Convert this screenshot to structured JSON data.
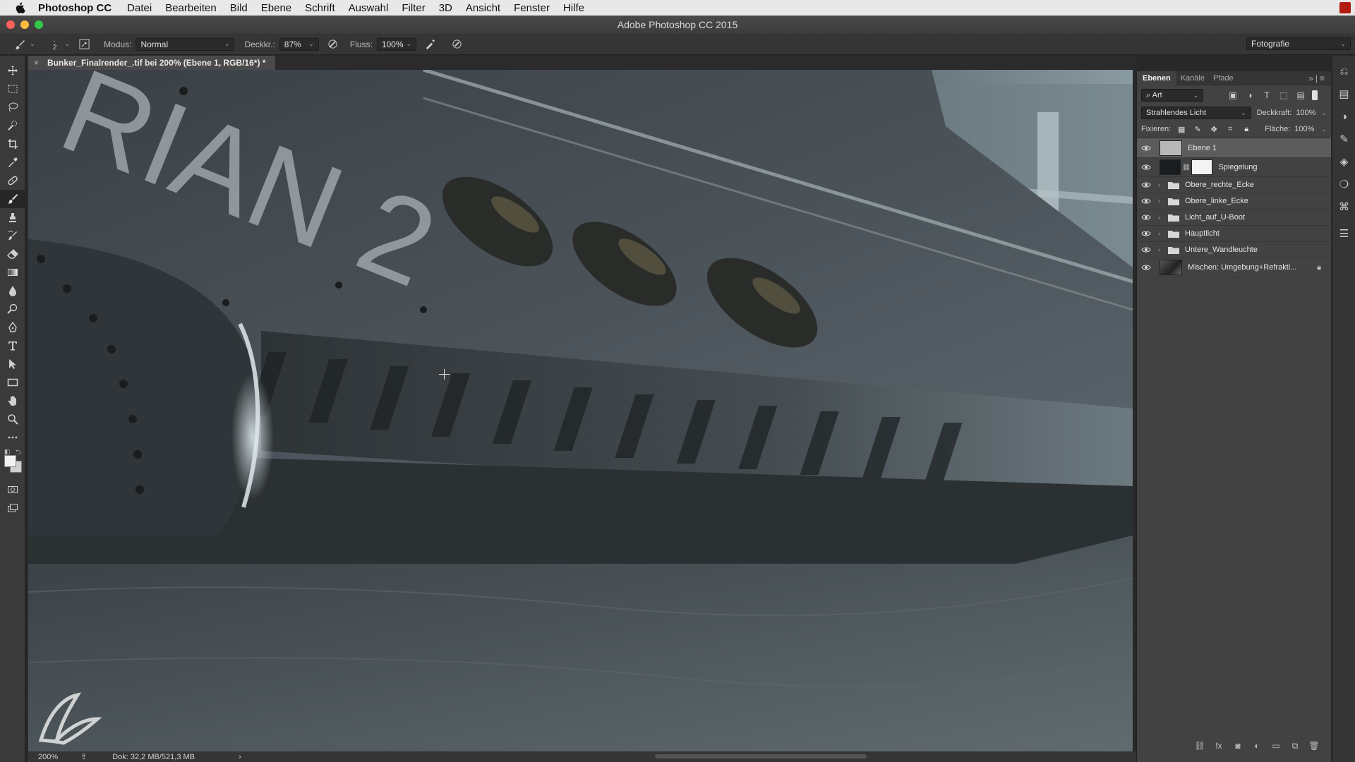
{
  "menubar": {
    "app_name": "Photoshop CC",
    "items": [
      "Datei",
      "Bearbeiten",
      "Bild",
      "Ebene",
      "Schrift",
      "Auswahl",
      "Filter",
      "3D",
      "Ansicht",
      "Fenster",
      "Hilfe"
    ]
  },
  "window": {
    "title": "Adobe Photoshop CC 2015"
  },
  "options_bar": {
    "brush_size": "2",
    "mode_label": "Modus:",
    "mode_value": "Normal",
    "opacity_label": "Deckkr.:",
    "opacity_value": "87%",
    "flow_label": "Fluss:",
    "flow_value": "100%",
    "workspace": "Fotografie"
  },
  "document": {
    "tab_title": "Bunker_Finalrender_.tif bei 200% (Ebene 1, RGB/16*) *",
    "canvas_text": "RIAN 2"
  },
  "status_bar": {
    "zoom": "200%",
    "doc_info": "Dok: 32,2 MB/521,3 MB"
  },
  "layers_panel": {
    "tabs": [
      "Ebenen",
      "Kanäle",
      "Pfade"
    ],
    "filter_kind": "Art",
    "blend_mode": "Strahlendes Licht",
    "opacity_label": "Deckkraft:",
    "opacity_value": "100%",
    "lock_label": "Fixieren:",
    "fill_label": "Fläche:",
    "fill_value": "100%",
    "layers": [
      {
        "name": "Ebene 1",
        "type": "pixel",
        "selected": true
      },
      {
        "name": "Spiegelung",
        "type": "adjustment-mask",
        "selected": false
      },
      {
        "name": "Obere_rechte_Ecke",
        "type": "group",
        "selected": false
      },
      {
        "name": "Obere_linke_Ecke",
        "type": "group",
        "selected": false
      },
      {
        "name": "Licht_auf_U-Boot",
        "type": "group",
        "selected": false
      },
      {
        "name": "Hauptlicht",
        "type": "group",
        "selected": false
      },
      {
        "name": "Untere_Wandleuchte",
        "type": "group",
        "selected": false
      },
      {
        "name": "Mischen: Umgebung+Refrakti...",
        "type": "pixel-locked",
        "selected": false
      }
    ]
  },
  "colors": {
    "menubar_bg": "#e8e8e8",
    "ui_dark": "#353535",
    "panel_bg": "#424242",
    "selected_layer": "#5c5c5c",
    "traffic_red": "#fc605b",
    "traffic_yellow": "#fdbc40",
    "traffic_green": "#34c84a"
  }
}
